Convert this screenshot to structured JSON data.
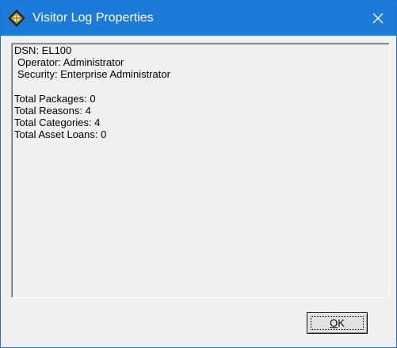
{
  "window": {
    "title": "Visitor Log Properties"
  },
  "info": {
    "dsn": "DSN: EL100",
    "operator": "Operator:  Administrator",
    "security": "Security: Enterprise Administrator",
    "total_packages": "Total Packages: 0",
    "total_reasons": "Total Reasons: 4",
    "total_categories": "Total Categories: 4",
    "total_asset_loans": "Total Asset Loans: 0"
  },
  "buttons": {
    "ok_mnemonic": "O",
    "ok_rest": "K"
  },
  "icons": {
    "app": "visitor-log-diamond-icon",
    "close": "close-icon"
  },
  "colors": {
    "titlebar": "#1c7bd9",
    "window_bg": "#f0f0f0"
  }
}
